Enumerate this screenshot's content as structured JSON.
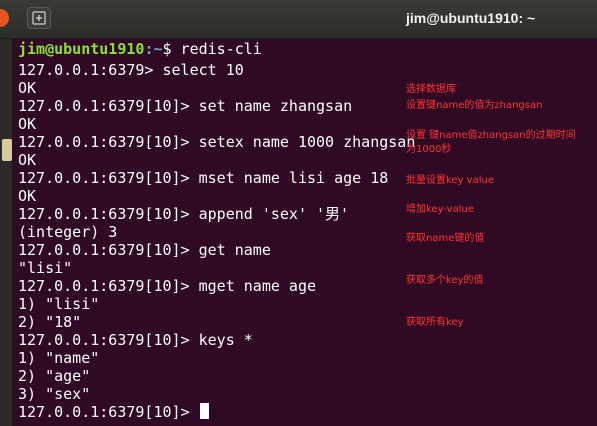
{
  "window": {
    "title": "jim@ubuntu1910: ~"
  },
  "icons": {
    "new_tab": "new-tab-icon",
    "close": "close-icon"
  },
  "colors": {
    "terminal_bg": "#300a24",
    "prompt_user": "#8ae234",
    "prompt_path": "#729fcf",
    "annotation": "#ff3333"
  },
  "terminal": {
    "prompt_user": "jim@ubuntu1910",
    "prompt_path": ":~",
    "prompt_symbol": "$ redis-cli",
    "lines": [
      "127.0.0.1:6379> select 10",
      "OK",
      "127.0.0.1:6379[10]> set name zhangsan",
      "OK",
      "127.0.0.1:6379[10]> setex name 1000 zhangsan",
      "OK",
      "127.0.0.1:6379[10]> mset name lisi age 18",
      "OK",
      "127.0.0.1:6379[10]> append 'sex' '男'",
      "(integer) 3",
      "127.0.0.1:6379[10]> get name",
      "\"lisi\"",
      "127.0.0.1:6379[10]> mget name age",
      "1) \"lisi\"",
      "2) \"18\"",
      "127.0.0.1:6379[10]> keys *",
      "1) \"name\"",
      "2) \"age\"",
      "3) \"sex\""
    ],
    "last_prompt": "127.0.0.1:6379[10]> "
  },
  "annotations": [
    "选择数据库",
    "设置键name的值为zhangsan",
    "设置 键name值zhangsan的过期时间",
    "为1000秒",
    "批量设置key value",
    "增加key-value",
    "获取name键的值",
    "获取多个key的值",
    "获取所有key"
  ]
}
